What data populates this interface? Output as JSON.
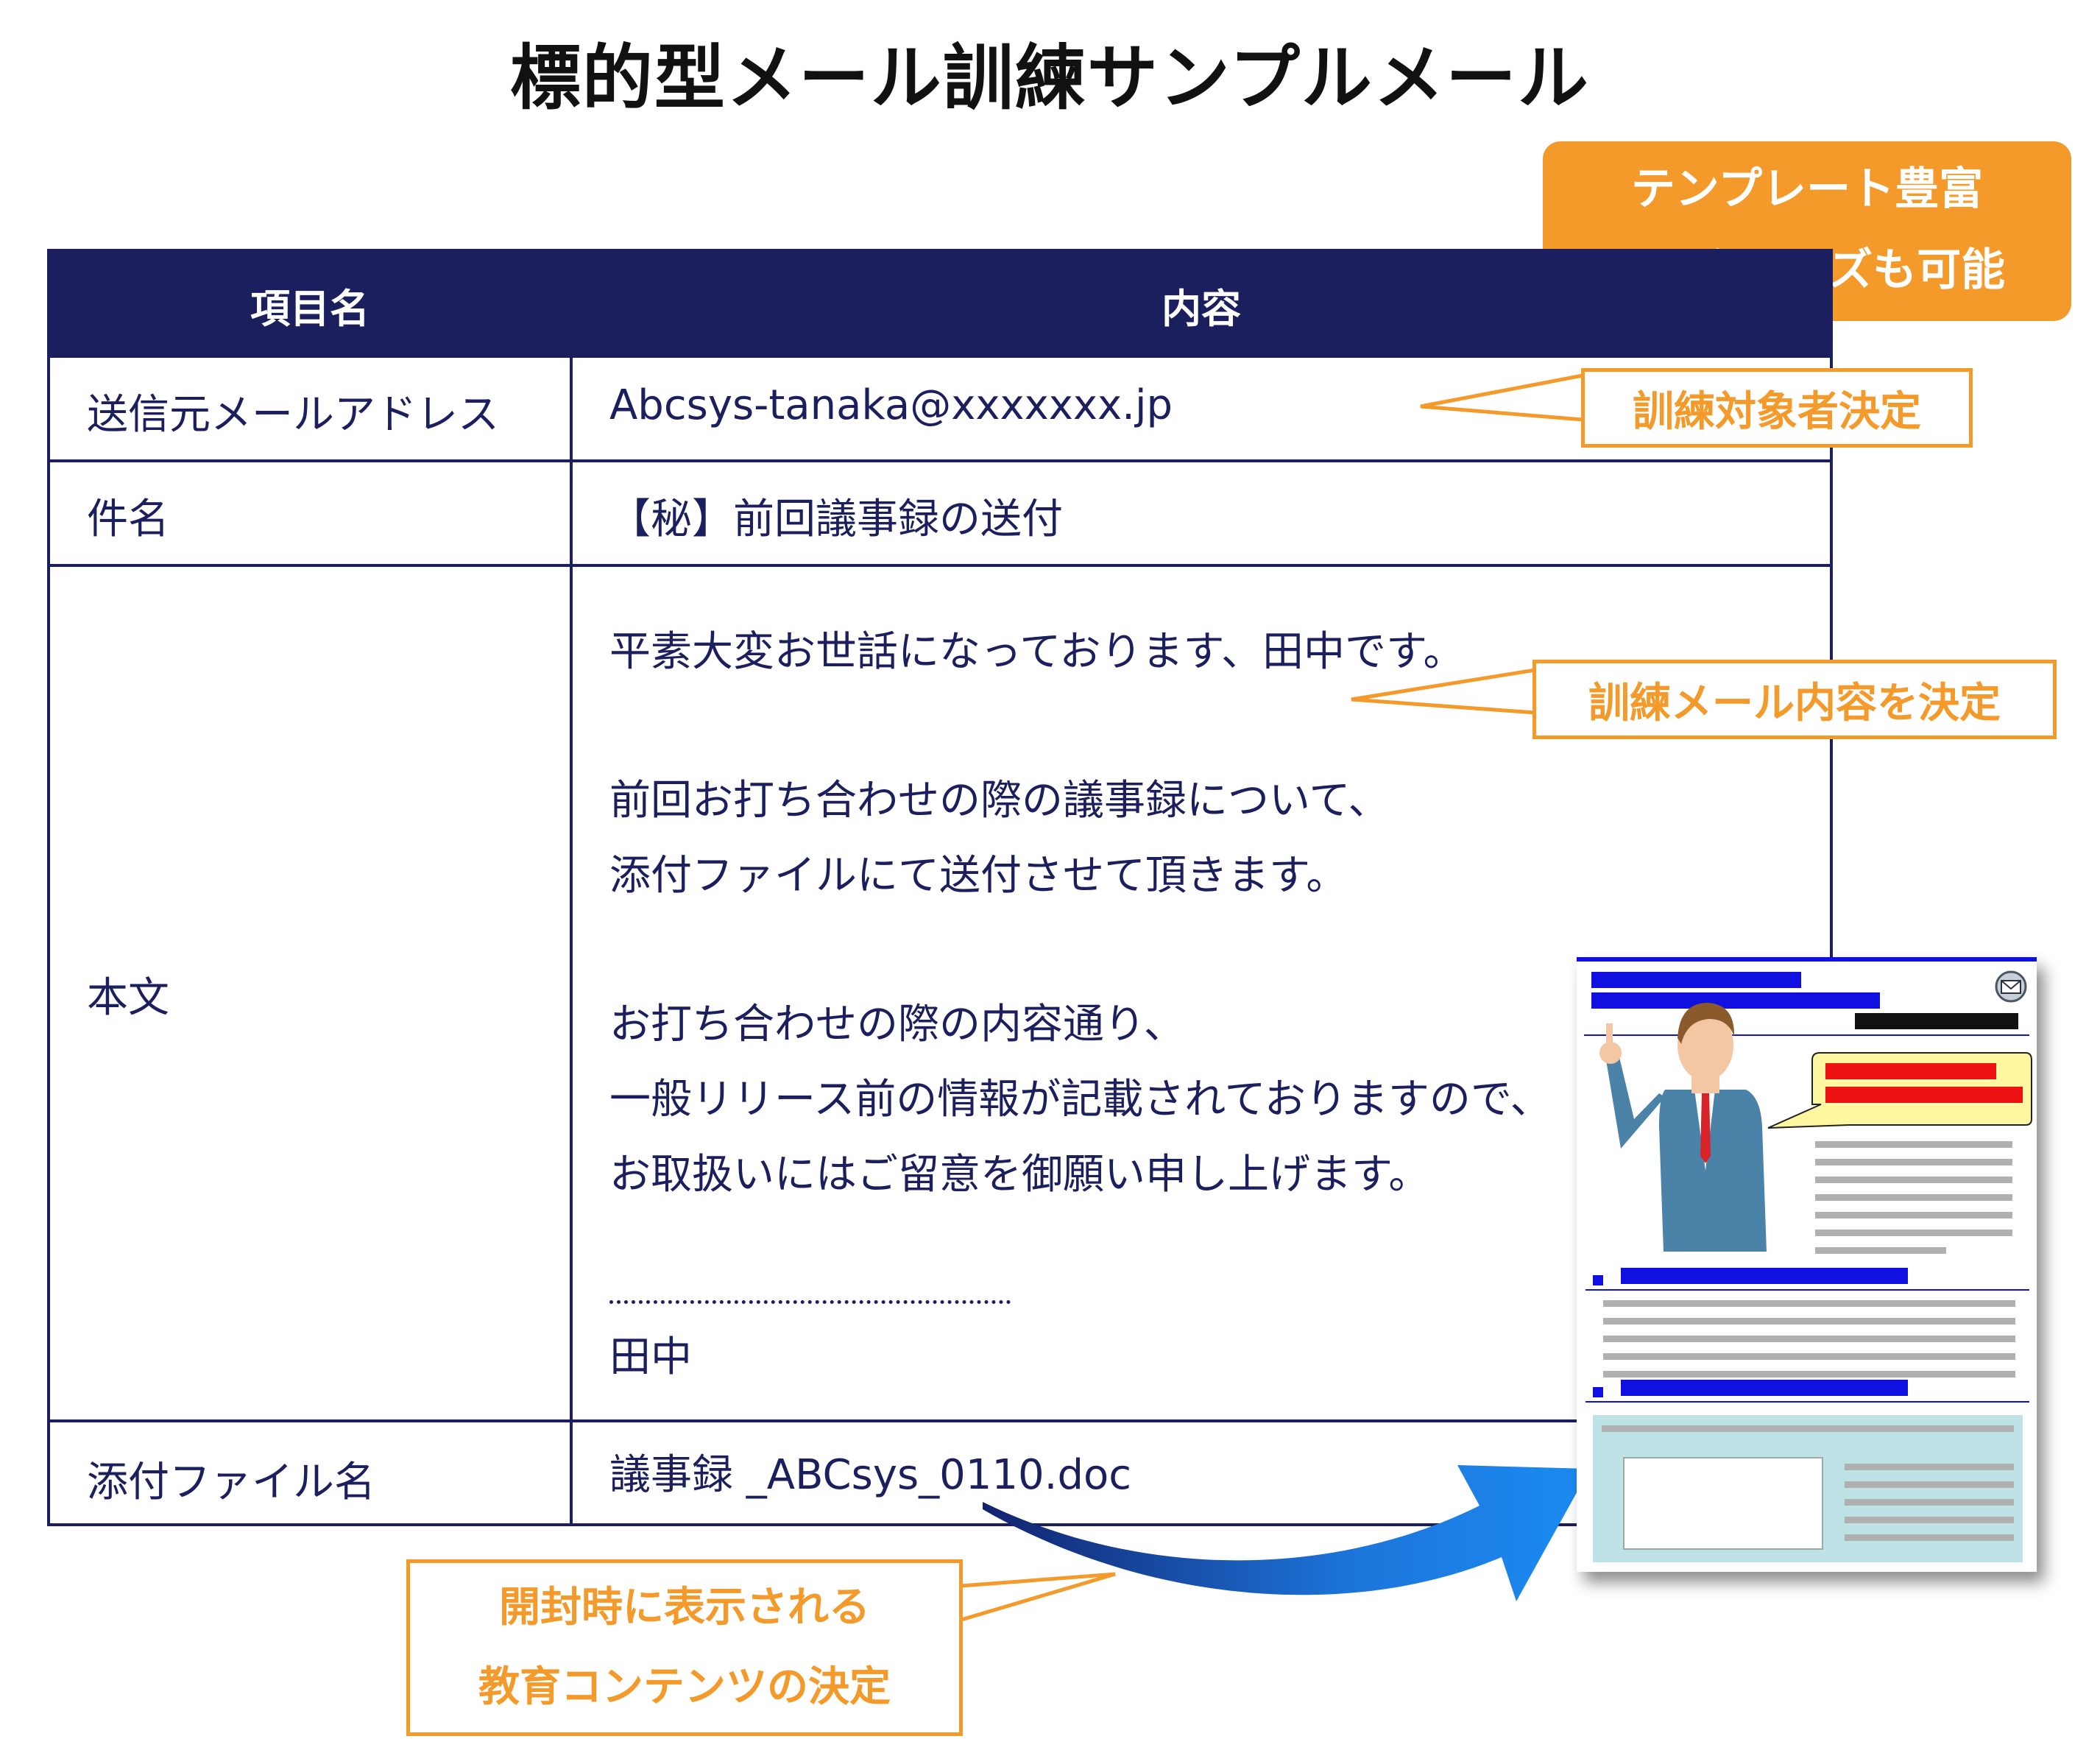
{
  "title": "標的型メール訓練サンプルメール",
  "table": {
    "header": {
      "col1": "項目名",
      "col2": "内容"
    },
    "rows": {
      "sender": {
        "label": "送信元メールアドレス",
        "value": "Abcsys-tanaka@xxxxxxx.jp"
      },
      "subject": {
        "label": "件名",
        "value": "【秘】前回議事録の送付"
      },
      "body": {
        "label": "本文",
        "lines": [
          "平素大変お世話になっております、田中です。",
          "前回お打ち合わせの際の議事録について、",
          "添付ファイルにて送付させて頂きます。",
          "お打ち合わせの際の内容通り、",
          "一般リリース前の情報が記載されておりますので、",
          "お取扱いにはご留意を御願い申し上げます。",
          "田中"
        ]
      },
      "attachment": {
        "label": "添付ファイル名",
        "value": "議事録 _ABCsys_0110.doc"
      }
    }
  },
  "callouts": {
    "template": {
      "line1": "テンプレート豊富",
      "line2": "カスタマイズも可能"
    },
    "target": "訓練対象者決定",
    "content": "訓練メール内容を決定",
    "education": {
      "line1": "開封時に表示される",
      "line2": "教育コンテンツの決定"
    }
  },
  "colors": {
    "navy": "#1c1f5e",
    "orange": "#f39a2b",
    "mock_blue": "#1010e0",
    "mock_red": "#ee1111",
    "mock_cyan": "#bfe2e6"
  },
  "mock_page": {
    "icon": "mail-icon",
    "illustration": "businessman-pointing-icon"
  }
}
